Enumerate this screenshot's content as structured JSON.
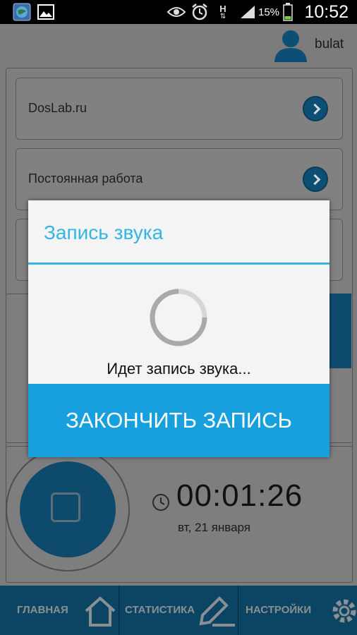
{
  "status_bar": {
    "battery_percent": "15%",
    "time": "10:52",
    "signal_label": "H"
  },
  "header": {
    "username": "bulat"
  },
  "cards": [
    {
      "label": "DosLab.ru"
    },
    {
      "label": "Постоянная работа"
    }
  ],
  "timer": {
    "value": "00:01:26",
    "date": "вт, 21 января"
  },
  "nav": {
    "home_label": "ГЛАВНАЯ",
    "stats_label": "СТАТИСТИКА",
    "settings_label": "НАСТРОЙКИ"
  },
  "dialog": {
    "title": "Запись звука",
    "message": "Идет запись звука...",
    "button_label": "ЗАКОНЧИТЬ ЗАПИСЬ"
  },
  "colors": {
    "accent": "#33b5e5",
    "button": "#17a0dd",
    "dark_blue": "#0c4463"
  }
}
